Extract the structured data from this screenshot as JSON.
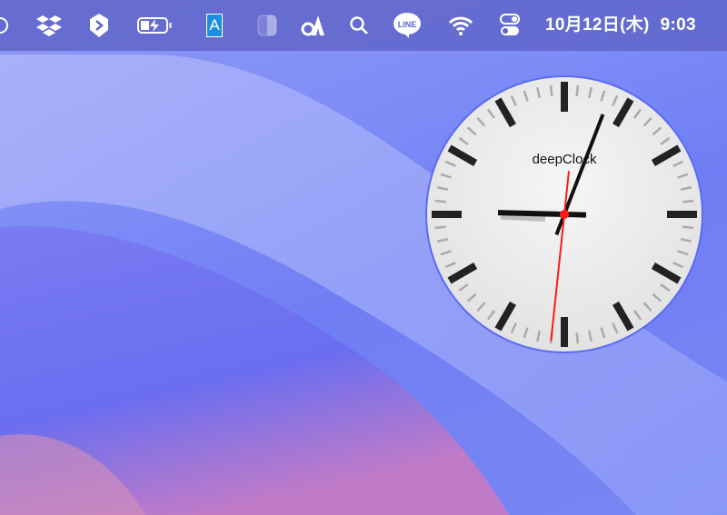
{
  "menubar": {
    "icons": [
      "partial-circle-icon",
      "dropbox-icon",
      "hexagon-app-icon",
      "battery-charging-icon",
      "text-input-a-icon",
      "half-square-icon",
      "translate-a-icon",
      "search-icon",
      "line-app-icon",
      "wifi-icon",
      "control-center-icon"
    ],
    "line_label": "LINE",
    "input_label": "A",
    "date": "10月12日(木)",
    "time": "9:03"
  },
  "widget": {
    "app_name": "deepClock",
    "hours": 9,
    "minutes": 3,
    "seconds": 31,
    "second_hand_color": "#ff1a1a"
  },
  "colors": {
    "menubar": "#5f64c8",
    "accent_input": "#1a8fe0"
  }
}
